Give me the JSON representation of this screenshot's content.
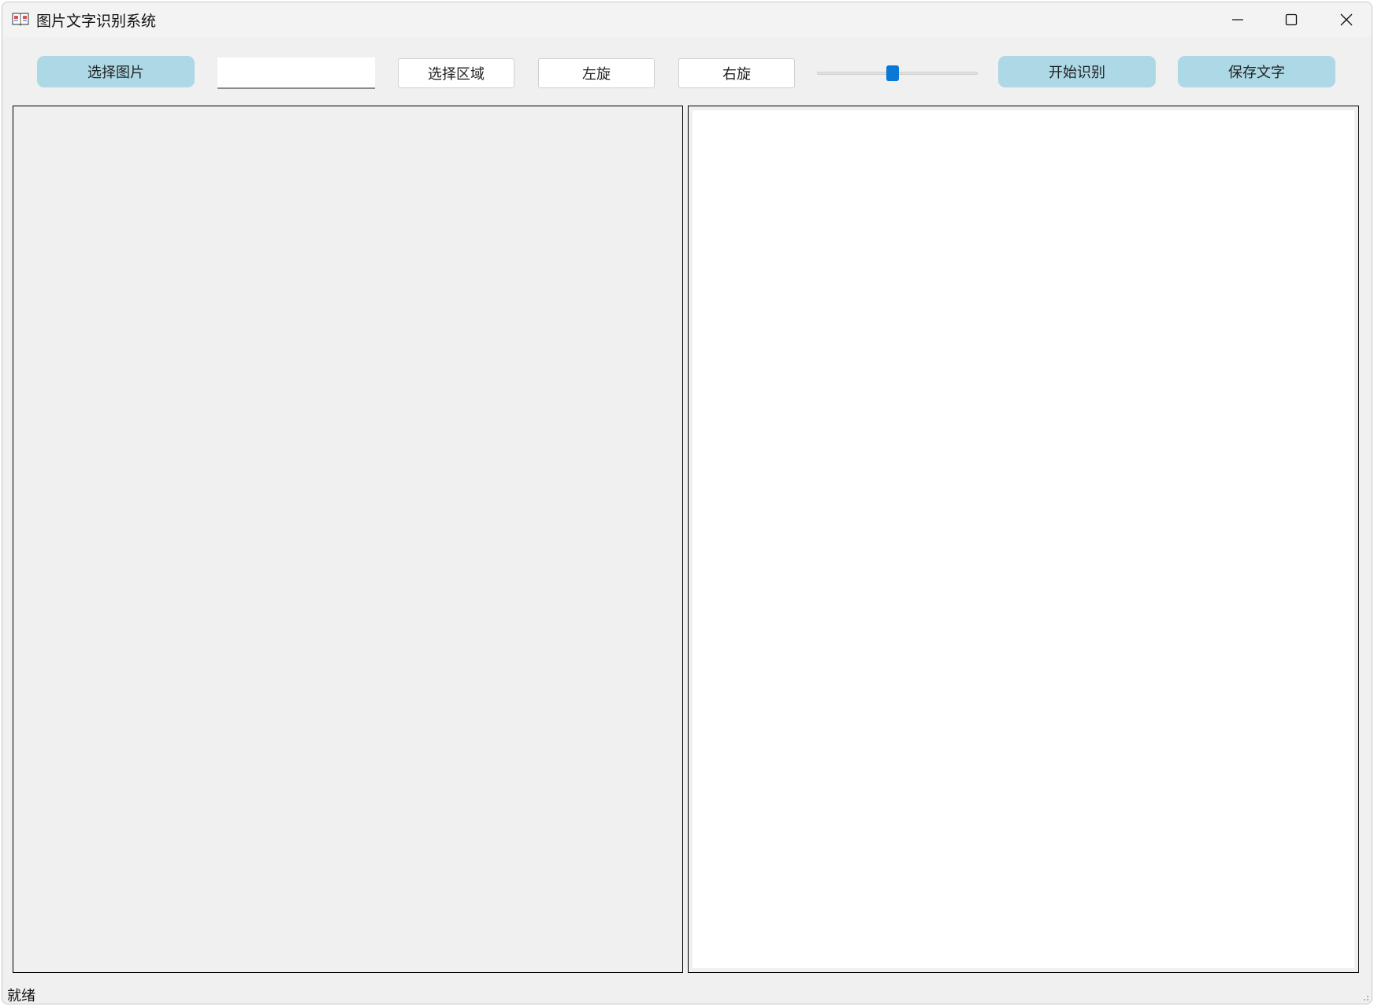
{
  "window": {
    "title": "图片文字识别系统",
    "icon": "open-book-icon",
    "controls": [
      "minimize-icon",
      "maximize-icon",
      "close-icon"
    ]
  },
  "toolbar": {
    "select_image_label": "选择图片",
    "path_input_value": "",
    "path_input_placeholder": "",
    "select_region_label": "选择区域",
    "rotate_left_label": "左旋",
    "rotate_right_label": "右旋",
    "zoom_slider_value": 0.47,
    "start_recognition_label": "开始识别",
    "save_text_label": "保存文字"
  },
  "image_panel": {
    "content": ""
  },
  "text_panel": {
    "content": ""
  },
  "status": {
    "text": "就绪"
  },
  "colors": {
    "accent_button": "#add8e6",
    "slider_thumb": "#0a78d7",
    "window_bg": "#f0f0f0"
  }
}
